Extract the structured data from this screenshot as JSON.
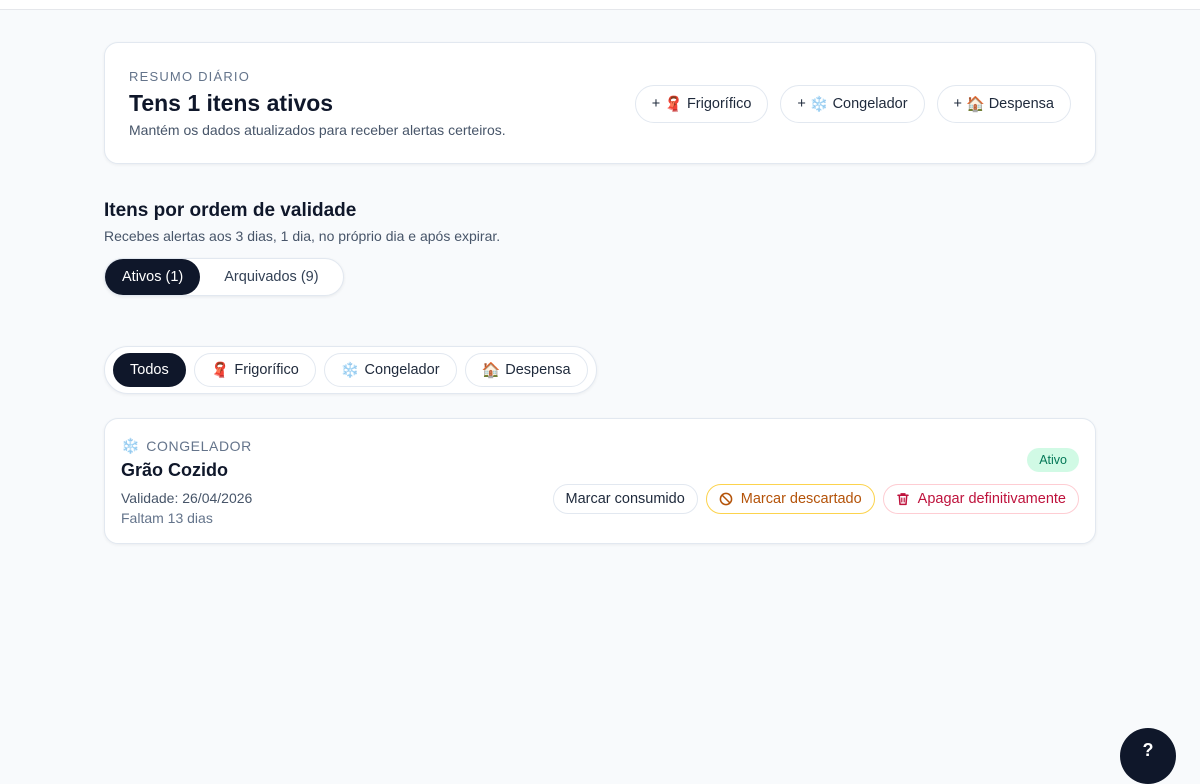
{
  "summary": {
    "eyebrow": "RESUMO DIÁRIO",
    "title": "Tens 1 itens ativos",
    "subtitle": "Mantém os dados atualizados para receber alertas certeiros.",
    "add_buttons": [
      {
        "plus": "+",
        "icon": "🧣",
        "label": "Frigorífico"
      },
      {
        "plus": "+",
        "icon": "❄️",
        "label": "Congelador"
      },
      {
        "plus": "+",
        "icon": "🏠",
        "label": "Despensa"
      }
    ]
  },
  "section": {
    "title": "Itens por ordem de validade",
    "subtitle": "Recebes alertas aos 3 dias, 1 dia, no próprio dia e após expirar."
  },
  "status_tabs": [
    {
      "label": "Ativos (1)",
      "active": true
    },
    {
      "label": "Arquivados (9)",
      "active": false
    }
  ],
  "filters": [
    {
      "icon": "",
      "label": "Todos",
      "active": true
    },
    {
      "icon": "🧣",
      "label": "Frigorífico",
      "active": false
    },
    {
      "icon": "❄️",
      "label": "Congelador",
      "active": false
    },
    {
      "icon": "🏠",
      "label": "Despensa",
      "active": false
    }
  ],
  "item": {
    "category_icon": "❄️",
    "category": "CONGELADOR",
    "name": "Grão Cozido",
    "validity": "Validade: 26/04/2026",
    "remaining": "Faltam 13 dias",
    "status": "Ativo",
    "actions": {
      "consumed": "Marcar consumido",
      "discarded": "Marcar descartado",
      "delete": "Apagar definitivamente"
    }
  },
  "fab": {
    "label": "?"
  }
}
